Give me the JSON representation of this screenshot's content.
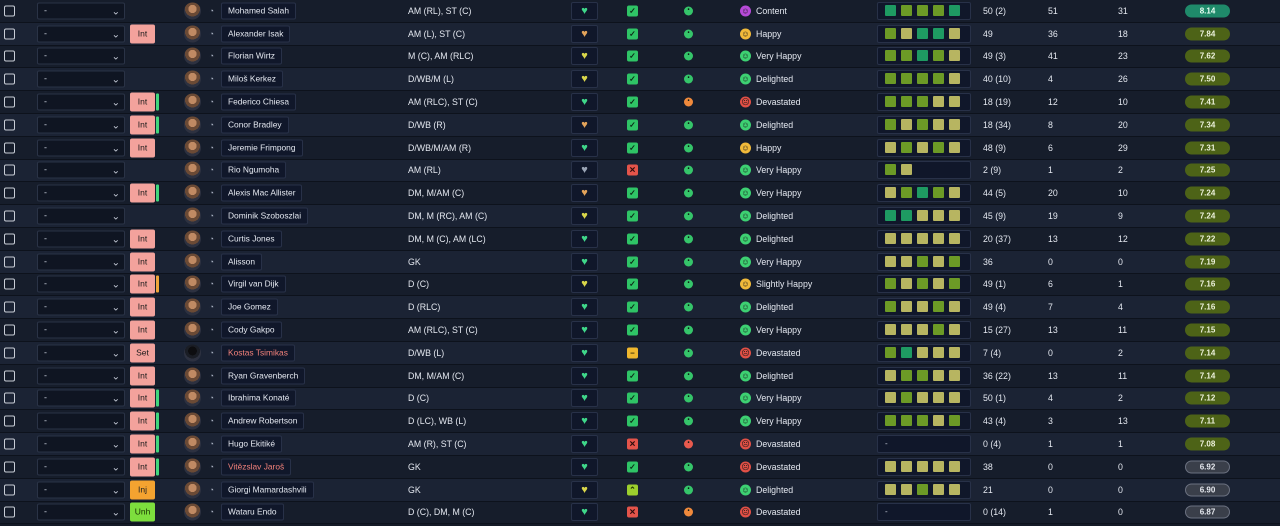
{
  "dropdown_default": "-",
  "rows": [
    {
      "name": "Mohamed Salah",
      "name_style": "normal",
      "position": "AM (RL), ST (C)",
      "status": "",
      "status_bar": "",
      "heart": "green",
      "ok": "yes",
      "dot": "green",
      "mood": "Content",
      "mood_color": "purple",
      "form": [
        "t",
        "g",
        "g",
        "g",
        "t"
      ],
      "apps": "50 (2)",
      "goals": "51",
      "assists": "31",
      "rating": "8.14",
      "rating_style": "teal"
    },
    {
      "name": "Alexander Isak",
      "name_style": "normal",
      "position": "AM (L), ST (C)",
      "status": "Int",
      "status_bar": "",
      "heart": "orange",
      "ok": "yes",
      "dot": "green",
      "mood": "Happy",
      "mood_color": "yellow",
      "form": [
        "g",
        "s",
        "t",
        "t",
        "s"
      ],
      "apps": "49",
      "goals": "36",
      "assists": "18",
      "rating": "7.84",
      "rating_style": "olive"
    },
    {
      "name": "Florian Wirtz",
      "name_style": "normal",
      "position": "M (C), AM (RLC)",
      "status": "",
      "status_bar": "",
      "heart": "yellow",
      "ok": "yes",
      "dot": "green",
      "mood": "Very Happy",
      "mood_color": "green",
      "form": [
        "g",
        "g",
        "t",
        "g",
        "s"
      ],
      "apps": "49 (3)",
      "goals": "41",
      "assists": "23",
      "rating": "7.62",
      "rating_style": "olive"
    },
    {
      "name": "Miloš Kerkez",
      "name_style": "normal",
      "position": "D/WB/M (L)",
      "status": "",
      "status_bar": "",
      "heart": "yellow",
      "ok": "yes",
      "dot": "green",
      "mood": "Delighted",
      "mood_color": "green",
      "form": [
        "g",
        "g",
        "g",
        "g",
        "s"
      ],
      "apps": "40 (10)",
      "goals": "4",
      "assists": "26",
      "rating": "7.50",
      "rating_style": "olive"
    },
    {
      "name": "Federico Chiesa",
      "name_style": "normal",
      "position": "AM (RLC), ST (C)",
      "status": "Int",
      "status_bar": "green",
      "heart": "green",
      "ok": "yes",
      "dot": "orange",
      "mood": "Devastated",
      "mood_color": "red",
      "form": [
        "g",
        "g",
        "g",
        "s",
        "s"
      ],
      "apps": "18 (19)",
      "goals": "12",
      "assists": "10",
      "rating": "7.41",
      "rating_style": "olive"
    },
    {
      "name": "Conor Bradley",
      "name_style": "normal",
      "position": "D/WB (R)",
      "status": "Int",
      "status_bar": "green",
      "heart": "orange",
      "ok": "yes",
      "dot": "green",
      "mood": "Delighted",
      "mood_color": "green",
      "form": [
        "g",
        "s",
        "g",
        "s",
        "s"
      ],
      "apps": "18 (34)",
      "goals": "8",
      "assists": "20",
      "rating": "7.34",
      "rating_style": "olive"
    },
    {
      "name": "Jeremie Frimpong",
      "name_style": "normal",
      "position": "D/WB/M/AM (R)",
      "status": "Int",
      "status_bar": "",
      "heart": "green",
      "ok": "yes",
      "dot": "green",
      "mood": "Happy",
      "mood_color": "yellow",
      "form": [
        "s",
        "g",
        "s",
        "g",
        "s"
      ],
      "apps": "48 (9)",
      "goals": "6",
      "assists": "29",
      "rating": "7.31",
      "rating_style": "olive"
    },
    {
      "name": "Rio Ngumoha",
      "name_style": "normal",
      "position": "AM (RL)",
      "status": "",
      "status_bar": "",
      "heart": "gray",
      "ok": "no",
      "dot": "green",
      "mood": "Very Happy",
      "mood_color": "green",
      "form": [
        "g",
        "s"
      ],
      "apps": "2 (9)",
      "goals": "1",
      "assists": "2",
      "rating": "7.25",
      "rating_style": "olive"
    },
    {
      "name": "Alexis Mac Allister",
      "name_style": "normal",
      "position": "DM, M/AM (C)",
      "status": "Int",
      "status_bar": "green",
      "heart": "orange",
      "ok": "yes",
      "dot": "green",
      "mood": "Very Happy",
      "mood_color": "green",
      "form": [
        "s",
        "g",
        "t",
        "g",
        "s"
      ],
      "apps": "44 (5)",
      "goals": "20",
      "assists": "10",
      "rating": "7.24",
      "rating_style": "olive"
    },
    {
      "name": "Dominik Szoboszlai",
      "name_style": "normal",
      "position": "DM, M (RC), AM (C)",
      "status": "",
      "status_bar": "",
      "heart": "yellow",
      "ok": "yes",
      "dot": "green",
      "mood": "Delighted",
      "mood_color": "green",
      "form": [
        "t",
        "t",
        "s",
        "s",
        "s"
      ],
      "apps": "45 (9)",
      "goals": "19",
      "assists": "9",
      "rating": "7.24",
      "rating_style": "olive"
    },
    {
      "name": "Curtis Jones",
      "name_style": "normal",
      "position": "DM, M (C), AM (LC)",
      "status": "Int",
      "status_bar": "",
      "heart": "green",
      "ok": "yes",
      "dot": "green",
      "mood": "Delighted",
      "mood_color": "green",
      "form": [
        "s",
        "s",
        "s",
        "s",
        "s"
      ],
      "apps": "20 (37)",
      "goals": "13",
      "assists": "12",
      "rating": "7.22",
      "rating_style": "olive"
    },
    {
      "name": "Alisson",
      "name_style": "normal",
      "position": "GK",
      "status": "Int",
      "status_bar": "",
      "heart": "green",
      "ok": "yes",
      "dot": "green",
      "mood": "Very Happy",
      "mood_color": "green",
      "form": [
        "s",
        "s",
        "g",
        "s",
        "g"
      ],
      "apps": "36",
      "goals": "0",
      "assists": "0",
      "rating": "7.19",
      "rating_style": "olive"
    },
    {
      "name": "Virgil van Dijk",
      "name_style": "normal",
      "position": "D (C)",
      "status": "Int",
      "status_bar": "orange",
      "heart": "yellow",
      "ok": "yes",
      "dot": "green",
      "mood": "Slightly Happy",
      "mood_color": "yellow",
      "form": [
        "g",
        "s",
        "g",
        "s",
        "g"
      ],
      "apps": "49 (1)",
      "goals": "6",
      "assists": "1",
      "rating": "7.16",
      "rating_style": "olive"
    },
    {
      "name": "Joe Gomez",
      "name_style": "normal",
      "position": "D (RLC)",
      "status": "Int",
      "status_bar": "",
      "heart": "green",
      "ok": "yes",
      "dot": "green",
      "mood": "Delighted",
      "mood_color": "green",
      "form": [
        "g",
        "s",
        "s",
        "g",
        "s"
      ],
      "apps": "49 (4)",
      "goals": "7",
      "assists": "4",
      "rating": "7.16",
      "rating_style": "olive"
    },
    {
      "name": "Cody Gakpo",
      "name_style": "normal",
      "position": "AM (RLC), ST (C)",
      "status": "Int",
      "status_bar": "",
      "heart": "green",
      "ok": "yes",
      "dot": "green",
      "mood": "Very Happy",
      "mood_color": "green",
      "form": [
        "s",
        "s",
        "s",
        "g",
        "s"
      ],
      "apps": "15 (27)",
      "goals": "13",
      "assists": "11",
      "rating": "7.15",
      "rating_style": "olive"
    },
    {
      "name": "Kostas Tsimikas",
      "name_style": "red",
      "position": "D/WB (L)",
      "status": "Set",
      "status_bar": "",
      "heart": "green",
      "ok": "mid",
      "dot": "green",
      "mood": "Devastated",
      "mood_color": "red",
      "form": [
        "g",
        "t",
        "s",
        "s",
        "s"
      ],
      "apps": "7 (4)",
      "goals": "0",
      "assists": "2",
      "rating": "7.14",
      "rating_style": "olive"
    },
    {
      "name": "Ryan Gravenberch",
      "name_style": "normal",
      "position": "DM, M/AM (C)",
      "status": "Int",
      "status_bar": "",
      "heart": "green",
      "ok": "yes",
      "dot": "green",
      "mood": "Delighted",
      "mood_color": "green",
      "form": [
        "s",
        "g",
        "g",
        "s",
        "s"
      ],
      "apps": "36 (22)",
      "goals": "13",
      "assists": "11",
      "rating": "7.14",
      "rating_style": "olive"
    },
    {
      "name": "Ibrahima Konaté",
      "name_style": "normal",
      "position": "D (C)",
      "status": "Int",
      "status_bar": "green",
      "heart": "green",
      "ok": "yes",
      "dot": "green",
      "mood": "Very Happy",
      "mood_color": "green",
      "form": [
        "s",
        "g",
        "s",
        "s",
        "s"
      ],
      "apps": "50 (1)",
      "goals": "4",
      "assists": "2",
      "rating": "7.12",
      "rating_style": "olive"
    },
    {
      "name": "Andrew Robertson",
      "name_style": "normal",
      "position": "D (LC), WB (L)",
      "status": "Int",
      "status_bar": "green",
      "heart": "green",
      "ok": "yes",
      "dot": "green",
      "mood": "Very Happy",
      "mood_color": "green",
      "form": [
        "g",
        "g",
        "g",
        "s",
        "g"
      ],
      "apps": "43 (4)",
      "goals": "3",
      "assists": "13",
      "rating": "7.11",
      "rating_style": "olive"
    },
    {
      "name": "Hugo Ekitiké",
      "name_style": "normal",
      "position": "AM (R), ST (C)",
      "status": "Int",
      "status_bar": "green",
      "heart": "green",
      "ok": "no",
      "dot": "red",
      "mood": "Devastated",
      "mood_color": "red",
      "form": [],
      "form_text": "-",
      "apps": "0 (4)",
      "goals": "1",
      "assists": "1",
      "rating": "7.08",
      "rating_style": "olive"
    },
    {
      "name": "Vitězslav Jaroš",
      "name_style": "red",
      "position": "GK",
      "status": "Int",
      "status_bar": "green",
      "heart": "green",
      "ok": "yes",
      "dot": "green",
      "mood": "Devastated",
      "mood_color": "red",
      "form": [
        "s",
        "s",
        "s",
        "s",
        "s"
      ],
      "apps": "38",
      "goals": "0",
      "assists": "0",
      "rating": "6.92",
      "rating_style": "gray"
    },
    {
      "name": "Giorgi Mamardashvili",
      "name_style": "normal",
      "position": "GK",
      "status": "Inj",
      "status_bar": "",
      "heart": "yellow",
      "ok": "up",
      "dot": "green",
      "mood": "Delighted",
      "mood_color": "green",
      "form": [
        "s",
        "s",
        "g",
        "s",
        "s"
      ],
      "apps": "21",
      "goals": "0",
      "assists": "0",
      "rating": "6.90",
      "rating_style": "gray"
    },
    {
      "name": "Wataru Endo",
      "name_style": "normal",
      "position": "D (C), DM, M (C)",
      "status": "Unh",
      "status_bar": "",
      "heart": "green",
      "ok": "no",
      "dot": "orange",
      "mood": "Devastated",
      "mood_color": "red",
      "form": [],
      "form_text": "-",
      "apps": "0 (14)",
      "goals": "1",
      "assists": "0",
      "rating": "6.87",
      "rating_style": "gray"
    }
  ]
}
